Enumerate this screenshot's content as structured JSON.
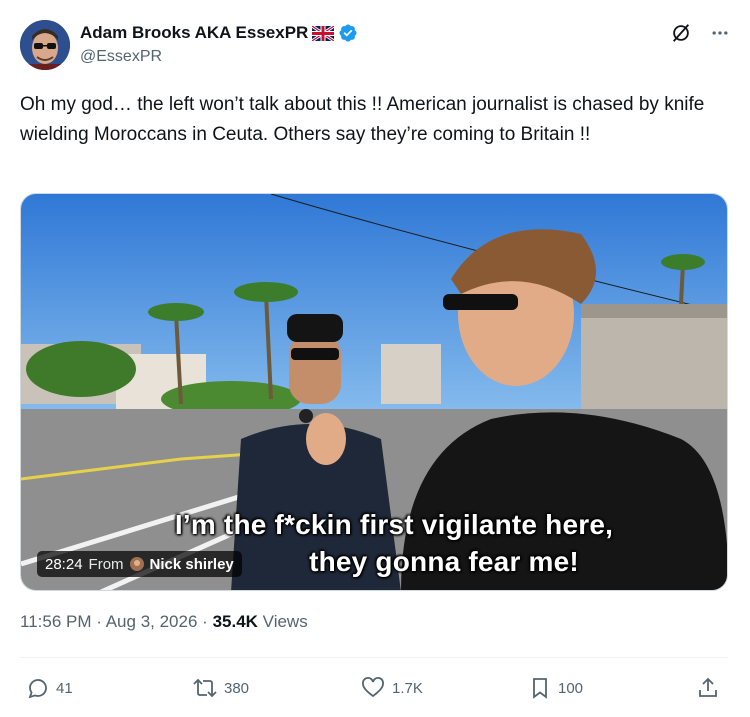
{
  "author": {
    "display_name": "Adam Brooks AKA EssexPR",
    "handle": "@EssexPR",
    "flag_icon": "uk-flag-icon",
    "verified_icon": "verified-badge-icon",
    "verified_color": "#1d9bf0"
  },
  "header_actions": {
    "grok_icon": "grok-icon",
    "more_icon": "more-dots-icon"
  },
  "tweet": {
    "text": "Oh my god… the left won’t talk about this !! American journalist is chased by knife wielding Moroccans in Ceuta. Others say they’re coming to Britain !!"
  },
  "media": {
    "caption_line1": "I’m the f*ckin first vigilante here,",
    "caption_line2": "they gonna fear me!",
    "duration": "28:24",
    "from_label": "From",
    "source_name": "Nick shirley"
  },
  "meta": {
    "time": "11:56 PM",
    "separator": "·",
    "date": "Aug 3, 2026",
    "views_count": "35.4K",
    "views_label": "Views"
  },
  "actions": {
    "replies": "41",
    "reposts": "380",
    "likes": "1.7K",
    "bookmarks": "100",
    "share_icon": "share-icon"
  }
}
